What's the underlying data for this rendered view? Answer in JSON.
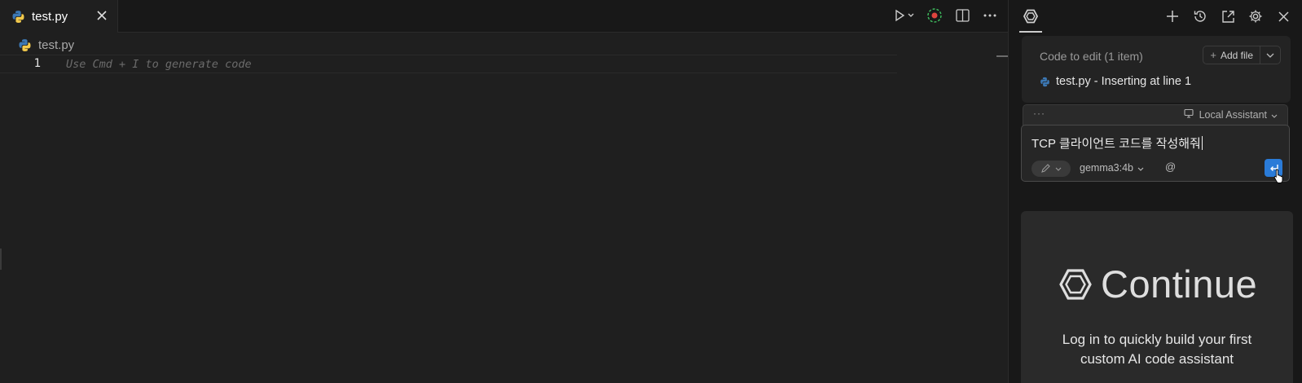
{
  "editor": {
    "tab": {
      "label": "test.py",
      "icon": "python-icon"
    },
    "toolbar": [
      "run-icon",
      "run-menu-chevron-icon",
      "debug-record-icon",
      "split-editor-icon",
      "more-actions-icon"
    ],
    "breadcrumb": {
      "label": "test.py"
    },
    "line_number": "1",
    "ghost_text": "Use Cmd + I to generate code"
  },
  "panel": {
    "header_actions": [
      "new-session-icon",
      "history-icon",
      "open-in-editor-icon",
      "settings-icon",
      "close-icon"
    ],
    "code_to_edit": {
      "title": "Code to edit (1 item)",
      "add_file_label": "Add file",
      "item_label": "test.py - Inserting at line 1"
    },
    "assistant_bar": {
      "dots": "···",
      "selected": "Local Assistant"
    },
    "input": {
      "value": "TCP 클라이언트 코드를 작성해줘",
      "mode_icon": "pencil-icon",
      "model": "gemma3:4b",
      "mention": "@",
      "submit_icon": "enter-icon"
    },
    "promo": {
      "brand": "Continue",
      "text": "Log in to quickly build your first custom AI code assistant"
    }
  },
  "colors": {
    "background": "#1f1f1f",
    "panel": "#181818",
    "accent": "#2a7bd8"
  }
}
